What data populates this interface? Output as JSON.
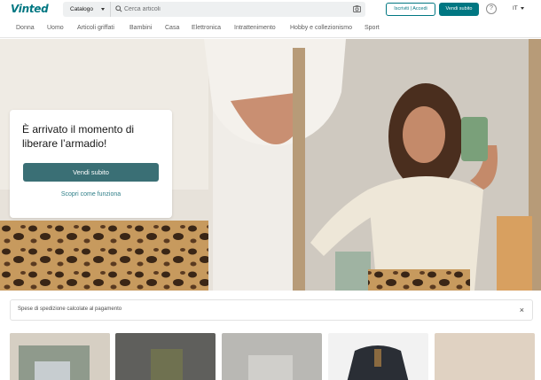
{
  "header": {
    "logo": "Vinted",
    "catalog_label": "Catalogo",
    "search_placeholder": "Cerca articoli",
    "login_label": "Iscriviti | Accedi",
    "sell_label": "Vendi subito",
    "help_label": "?",
    "language": "IT"
  },
  "categories": [
    "Donna",
    "Uomo",
    "Articoli griffati",
    "Bambini",
    "Casa",
    "Elettronica",
    "Intrattenimento",
    "Hobby e collezionismo",
    "Sport"
  ],
  "hero": {
    "title": "È arrivato il momento di liberare l’armadio!",
    "sell_label": "Vendi subito",
    "how_label": "Scopri come funziona"
  },
  "shipping_notice": {
    "text": "Spese di spedizione calcolate al pagamento",
    "close_label": "×"
  },
  "colors": {
    "brand": "#007782",
    "hero_button": "#3a6f75"
  }
}
